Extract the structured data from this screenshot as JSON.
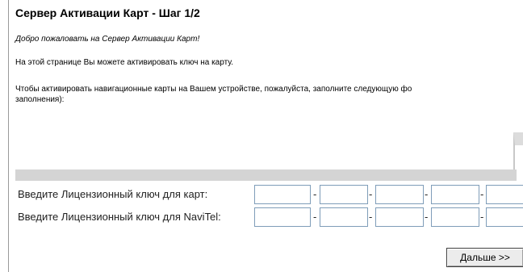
{
  "page": {
    "title": "Сервер Активации Карт - Шаг 1/2",
    "welcome": "Добро пожаловать на Сервер Активации Карт!",
    "intro": "На этой странице Вы можете активировать ключ на карту.",
    "instructions_line1": "Чтобы активировать навигационные карты на Вашем устройстве, пожалуйста, заполните следующую фо",
    "instructions_line2": "заполнения):"
  },
  "form": {
    "maps_key_label": "Введите Лицензионный ключ для карт:",
    "navitel_key_label": "Введите Лицензионный ключ для NaviTel:",
    "separator": "-",
    "maps_key_values": [
      "",
      "",
      "",
      "",
      ""
    ],
    "navitel_key_values": [
      "",
      "",
      "",
      "",
      ""
    ]
  },
  "buttons": {
    "next_label": "Дальше >>"
  }
}
